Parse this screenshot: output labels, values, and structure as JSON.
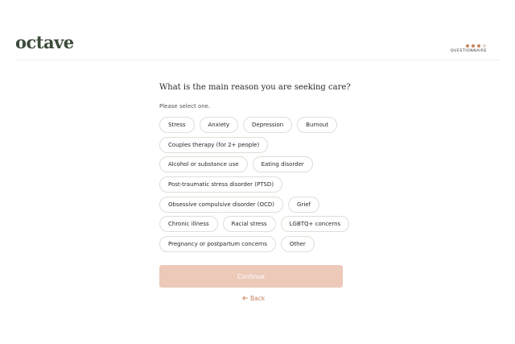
{
  "header": {
    "logo_text": "octave",
    "progress_label": "QUESTIONNAIRE",
    "progress_colors": [
      "#c9845e",
      "#c9845e",
      "#c9845e",
      "#e8d6cc"
    ]
  },
  "main": {
    "question": "What is the main reason you are seeking care?",
    "instruction": "Please select one.",
    "options": [
      [
        "Stress",
        "Anxiety",
        "Depression",
        "Burnout"
      ],
      [
        "Couples therapy (for 2+ people)"
      ],
      [
        "Alcohol or substance use",
        "Eating disorder"
      ],
      [
        "Post-traumatic stress disorder (PTSD)"
      ],
      [
        "Obsessive compulsive disorder (OCD)",
        "Grief"
      ],
      [
        "Chronic illness",
        "Racial stress",
        "LGBTQ+ concerns"
      ],
      [
        "Pregnancy or postpartum concerns",
        "Other"
      ]
    ],
    "continue_label": "Continue",
    "back_label": "Back",
    "back_icon": "arrow-left-icon"
  },
  "colors": {
    "brand": "#3c4a3a",
    "accent": "#c9845e",
    "continue_disabled_bg": "#ecc9b9"
  }
}
